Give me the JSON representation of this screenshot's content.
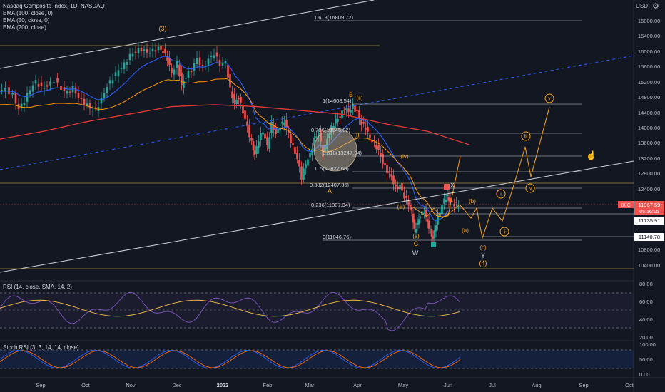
{
  "legend": {
    "title": "Nasdaq Composite Index, 1D, NASDAQ",
    "ema100": "EMA (100, close, 0)",
    "ema50": "EMA (50, close, 0)",
    "ema200": "EMA (200, close)"
  },
  "currency": "USD",
  "rsi_label": "RSI (14, close, SMA, 14, 2)",
  "stoch_label": "Stoch RSI (3, 3, 14, 14, close)",
  "price_axis": [
    "16800.00",
    "16400.00",
    "16000.00",
    "15600.00",
    "15200.00",
    "14800.00",
    "14400.00",
    "14000.00",
    "13600.00",
    "13200.00",
    "12800.00",
    "12400.00",
    "11600.00",
    "10800.00",
    "10400.00"
  ],
  "rsi_axis": [
    "80.00",
    "60.00",
    "40.00",
    "20.00"
  ],
  "stoch_axis": [
    "100.00",
    "50.00",
    "0.00"
  ],
  "time_axis": [
    "Sep",
    "Oct",
    "Nov",
    "Dec",
    "2022",
    "Feb",
    "Mar",
    "Apr",
    "May",
    "Jun",
    "Jul",
    "Aug",
    "Sep",
    "Oct"
  ],
  "price_tags": {
    "ticker": "IXIC",
    "last": "11967.59",
    "countdown": "05:16:15",
    "level1": "11735.91",
    "level2": "11140.78"
  },
  "fib": [
    "1.618(16809.72)",
    "1(14608.54)",
    "0.786(13846.82)",
    "0.618(13247.94)",
    "0.5(12827.65)",
    "0.382(12407.36)",
    "0.236(11887.34)",
    "0(11046.76)"
  ],
  "waves": {
    "w3": "(3)",
    "B": "B",
    "ii": "(ii)",
    "i": "(i)",
    "A": "A",
    "iv": "(iv)",
    "iii": "(iii)",
    "v": "(v)",
    "C": "C",
    "W": "W",
    "X": "X",
    "b": "(b)",
    "a": "(a)",
    "c": "(c)",
    "Y": "Y",
    "w4": "(4)",
    "proj_i": "i",
    "proj_ii": "ii",
    "proj_iii": "iii",
    "proj_iv": "iv",
    "proj_v": "v"
  },
  "colors": {
    "bg": "#131722",
    "up": "#26a69a",
    "down": "#ef5350",
    "ema50": "#2962ff",
    "ema100": "#ff9800",
    "ema200": "#e53935",
    "wave": "#f5a623",
    "rsi": "#7e57c2",
    "rsi_ma": "#f7c04a",
    "stoch_k": "#2962ff",
    "stoch_d": "#ff6d00"
  },
  "icons": [
    "settings-gear-icon",
    "hand-pointer-icon"
  ]
}
